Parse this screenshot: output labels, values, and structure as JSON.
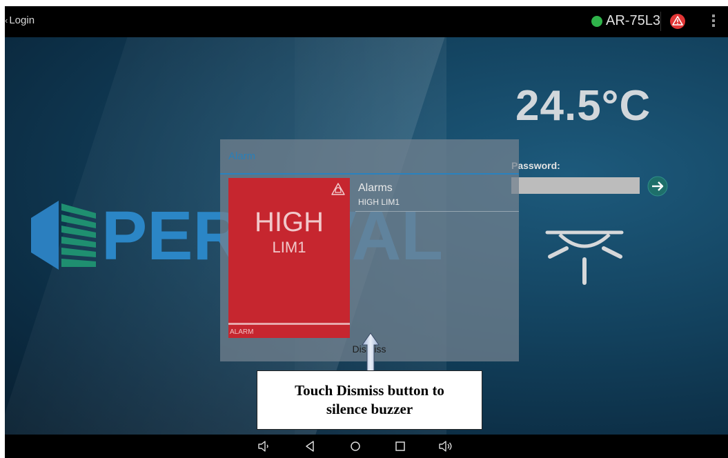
{
  "topbar": {
    "back_label": "Login",
    "device_name": "AR-75L3",
    "status_color": "#2fb34a",
    "alarm_icon": "alarm-bell-icon",
    "menu_icon": "overflow-menu-icon"
  },
  "background": {
    "brand": "PERCIVAL",
    "brand_colors": [
      "#2b86c6",
      "#1e8a6a"
    ]
  },
  "login": {
    "temperature": "24.5°C",
    "password_label": "Password:",
    "password_value": "",
    "submit_icon": "arrow-right-icon",
    "lamp_icon": "chamber-light-icon"
  },
  "dialog": {
    "title": "Alarm",
    "card": {
      "big": "HIGH",
      "small": "LIM1",
      "label": "ALARM",
      "color": "#c6262f"
    },
    "list_title": "Alarms",
    "list_item": "HIGH LIM1",
    "dismiss_label": "Dismiss",
    "accent": "#2a82bf"
  },
  "annotation": {
    "line1": "Touch Dismiss button to",
    "line2": "silence buzzer"
  },
  "navbar": {
    "icons": [
      "volume-down-icon",
      "back-icon",
      "home-icon",
      "recents-icon",
      "volume-up-icon"
    ]
  }
}
